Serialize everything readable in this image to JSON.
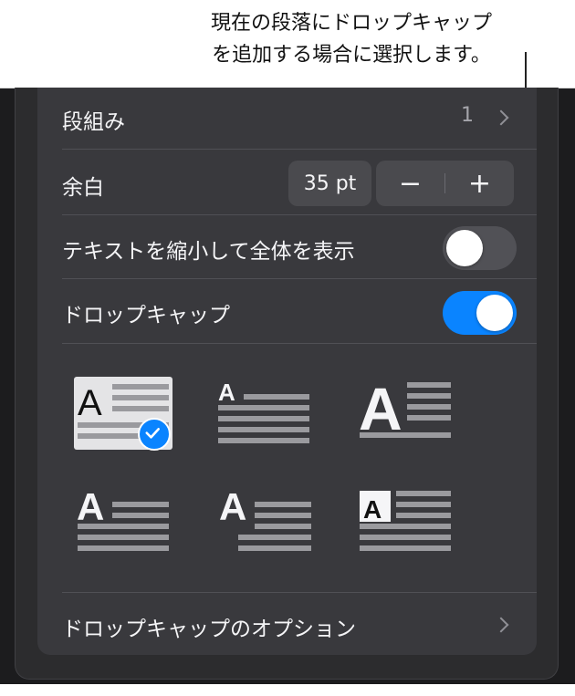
{
  "callout": {
    "text": "現在の段落にドロップキャップ\nを追加する場合に選択します。"
  },
  "columns": {
    "label": "段組み",
    "value": "1"
  },
  "margin": {
    "label": "余白",
    "value": "35 pt",
    "minus": "−",
    "plus": "+"
  },
  "shrink_text": {
    "label": "テキストを縮小して全体を表示",
    "on": false
  },
  "drop_cap": {
    "label": "ドロップキャップ",
    "on": true
  },
  "styles": [
    {
      "letter": "A",
      "selected": true
    },
    {
      "letter": "A",
      "selected": false
    },
    {
      "letter": "A",
      "selected": false
    },
    {
      "letter": "A",
      "selected": false
    },
    {
      "letter": "A",
      "selected": false
    },
    {
      "letter": "A",
      "selected": false
    }
  ],
  "options": {
    "label": "ドロップキャップのオプション"
  },
  "colors": {
    "accent": "#0a84ff",
    "panel": "#39393d",
    "text": "#f5f5f7",
    "toggle_off": "#515156"
  }
}
